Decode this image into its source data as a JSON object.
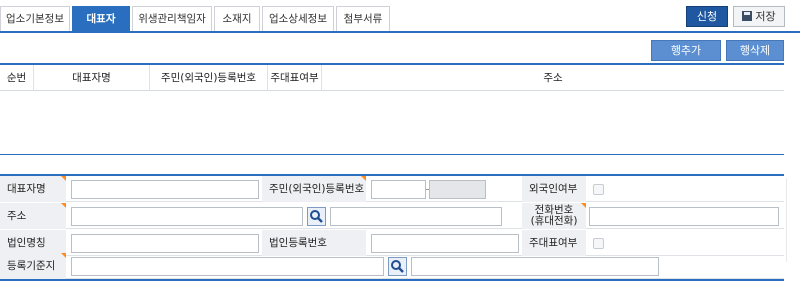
{
  "tabs": [
    {
      "label": "업소기본정보",
      "active": false
    },
    {
      "label": "대표자",
      "active": true
    },
    {
      "label": "위생관리책임자",
      "active": false
    },
    {
      "label": "소재지",
      "active": false
    },
    {
      "label": "업소상세정보",
      "active": false
    },
    {
      "label": "첨부서류",
      "active": false
    }
  ],
  "toolbar": {
    "apply_label": "신청",
    "save_label": "저장"
  },
  "grid": {
    "add_row_label": "행추가",
    "delete_row_label": "행삭제",
    "columns": [
      "순번",
      "대표자명",
      "주민(외국인)등록번호",
      "주대표여부",
      "주소"
    ],
    "rows": []
  },
  "form": {
    "rep_name_label": "대표자명",
    "resident_no_label": "주민(외국인)등록번호",
    "foreigner_label": "외국인여부",
    "address_label": "주소",
    "phone_label_1": "전화번호",
    "phone_label_2": "(휴대전화)",
    "corp_name_label": "법인명칭",
    "corp_reg_label": "법인등록번호",
    "main_rep_label": "주대표여부",
    "reg_basis_label": "등록기준지"
  },
  "colors": {
    "accent": "#2a6fbf",
    "apply_button": "#1f57a0",
    "row_button": "#5b8fd1",
    "required_marker": "#ff8c1a"
  },
  "icons": {
    "search": "magnifier-icon",
    "save": "floppy-disk-icon"
  }
}
